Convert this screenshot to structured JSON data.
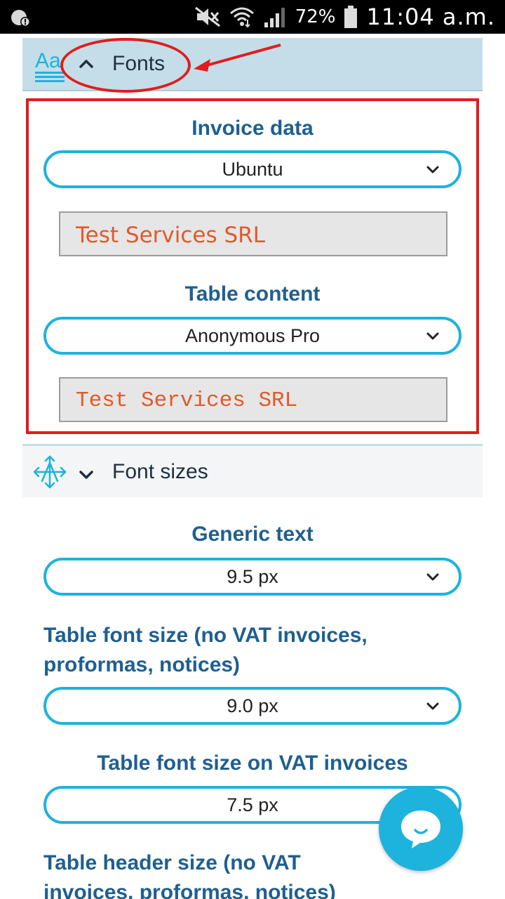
{
  "status_bar": {
    "battery_percent": "72%",
    "time": "11:04 a.m."
  },
  "fonts_section": {
    "title": "Fonts",
    "expanded": true,
    "invoice_data": {
      "label": "Invoice data",
      "selected_font": "Ubuntu",
      "preview_text": "Test Services SRL"
    },
    "table_content": {
      "label": "Table content",
      "selected_font": "Anonymous Pro",
      "preview_text": "Test Services SRL"
    }
  },
  "font_sizes_section": {
    "title": "Font sizes",
    "expanded": false,
    "generic_text": {
      "label": "Generic text",
      "value": "9.5 px"
    },
    "table_font_size_no_vat": {
      "label": "Table font size (no VAT invoices, proformas, notices)",
      "value": "9.0 px"
    },
    "table_font_size_vat": {
      "label": "Table font size on VAT invoices",
      "value": "7.5 px"
    },
    "table_header_size_no_vat": {
      "label": "Table header size (no VAT invoices, proformas, notices)"
    }
  },
  "colors": {
    "accent": "#1eb3dc",
    "label_blue": "#1f5f8f",
    "annotation_red": "#e01d1d",
    "preview_text": "#e05a2b"
  },
  "icons": {
    "fonts_header": "font-aa-icon",
    "font_sizes_header": "resize-arrows-icon",
    "chat": "chat-bubble-icon"
  }
}
